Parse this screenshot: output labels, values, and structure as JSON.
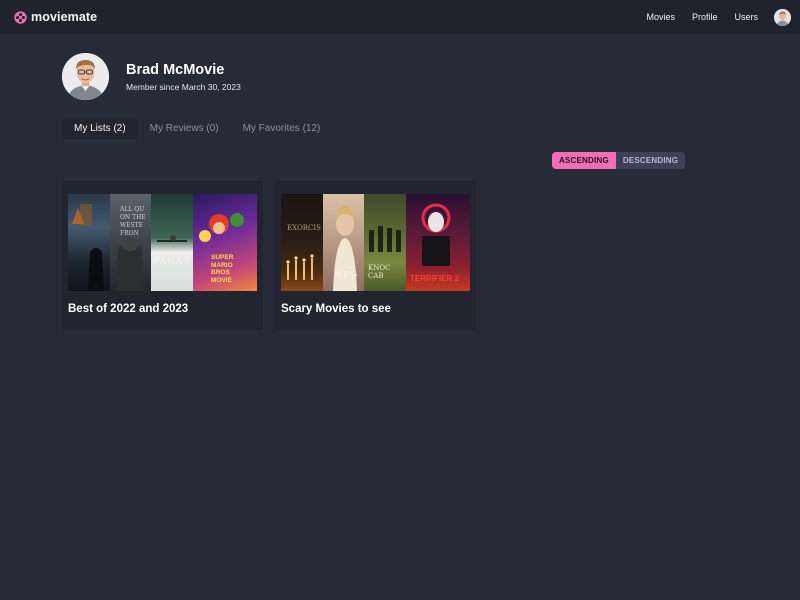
{
  "app": {
    "brand": "moviemate",
    "accent_color": "#f06fb4",
    "background_color": "#272a37",
    "topbar_color": "#20222d"
  },
  "nav": {
    "items": [
      "Movies",
      "Profile",
      "Users"
    ],
    "avatar_icon": "user-avatar"
  },
  "profile": {
    "name": "Brad McMovie",
    "member_since": "Member since March 30, 2023"
  },
  "tabs": [
    {
      "label": "My Lists (2)",
      "active": true
    },
    {
      "label": "My Reviews (0)",
      "active": false
    },
    {
      "label": "My Favorites (12)",
      "active": false
    }
  ],
  "sort": {
    "ascending": "ASCENDING",
    "descending": "DESCENDING",
    "selected": "ASCENDING"
  },
  "lists": [
    {
      "title": "Best of 2022 and 2023",
      "posters": [
        {
          "text": ""
        },
        {
          "text": "ALL QU\nON THE\nWESTE\nFRON"
        },
        {
          "text": "PARAS"
        },
        {
          "text": "SUPER\nMARIO\nBROS\nMOVIE"
        }
      ]
    },
    {
      "title": "Scary Movies to see",
      "posters": [
        {
          "text": "EXORCIS"
        },
        {
          "text": "MEG"
        },
        {
          "text": "KNOC\nCAB"
        },
        {
          "text": "TERRIFIER 2"
        }
      ]
    }
  ]
}
